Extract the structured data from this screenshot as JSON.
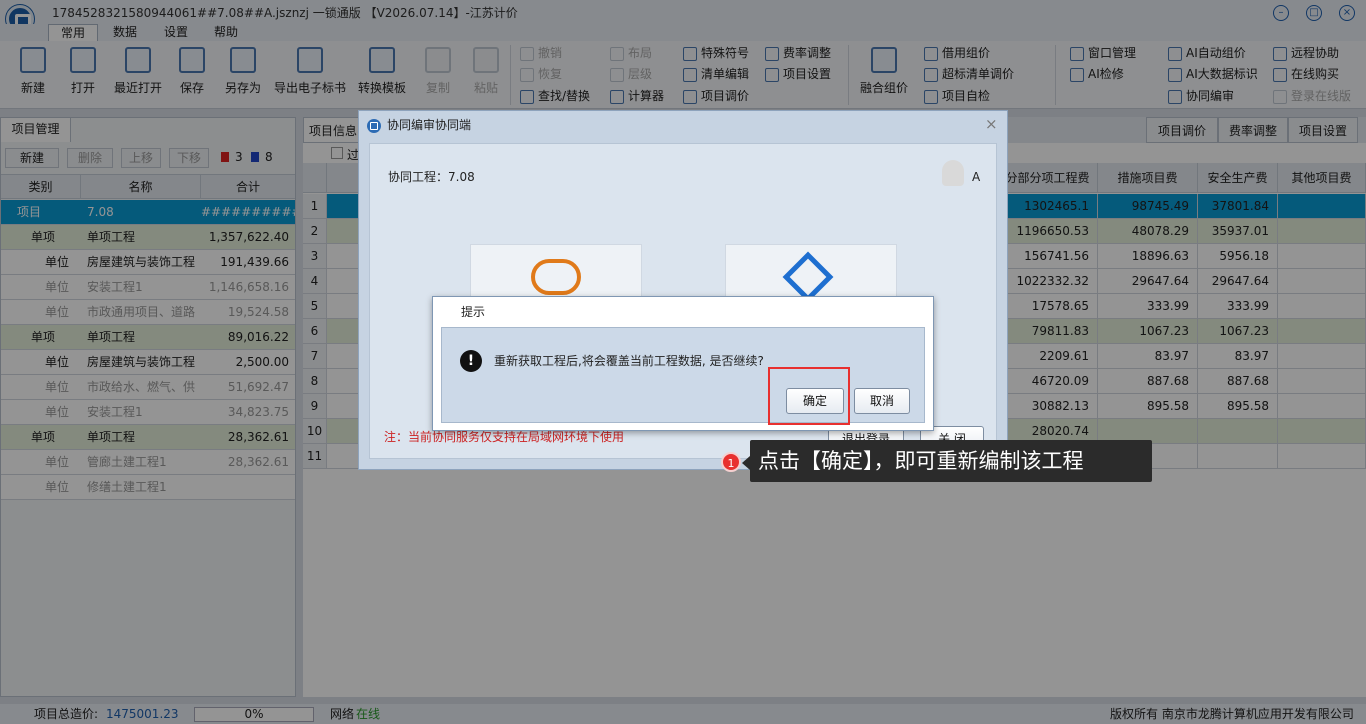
{
  "title": "1784528321580944061##7.08##A.jsznzj 一锁通版 【V2026.07.14】-江苏计价",
  "menu": [
    "常用",
    "数据",
    "设置",
    "帮助"
  ],
  "ribbon": {
    "big": [
      "新建",
      "打开",
      "最近打开",
      "保存",
      "另存为",
      "导出电子标书",
      "转换模板",
      "复制",
      "粘贴",
      "融合组价"
    ],
    "edit": [
      "撤销",
      "恢复",
      "查找/替换"
    ],
    "layout": [
      "布局",
      "层级",
      "计算器"
    ],
    "tools": [
      "特殊符号",
      "清单编辑",
      "项目调价"
    ],
    "rates": [
      "费率调整",
      "项目设置"
    ],
    "price": [
      "借用组价",
      "超标清单调价",
      "项目自检"
    ],
    "window": [
      "窗口管理",
      "AI检修"
    ],
    "ai": [
      "AI自动组价",
      "AI大数据标识",
      "协同编审"
    ],
    "remote": [
      "远程协助",
      "在线购买",
      "登录在线版"
    ]
  },
  "left": {
    "tab": "项目管理",
    "tools": {
      "new": "新建",
      "delete": "删除",
      "up": "上移",
      "down": "下移",
      "red_count": "3",
      "blue_count": "8"
    },
    "headers": [
      "类别",
      "名称",
      "合计"
    ],
    "rows": [
      {
        "type": "项目",
        "name": "7.08",
        "total": "###########"
      },
      {
        "type": "单项",
        "name": "单项工程",
        "total": "1,357,622.40"
      },
      {
        "type": "单位",
        "name": "房屋建筑与装饰工程",
        "total": "191,439.66"
      },
      {
        "type": "单位",
        "name": "安装工程1",
        "total": "1,146,658.16"
      },
      {
        "type": "单位",
        "name": "市政通用项目、道路",
        "total": "19,524.58"
      },
      {
        "type": "单项",
        "name": "单项工程",
        "total": "89,016.22"
      },
      {
        "type": "单位",
        "name": "房屋建筑与装饰工程",
        "total": "2,500.00"
      },
      {
        "type": "单位",
        "name": "市政给水、燃气、供",
        "total": "51,692.47"
      },
      {
        "type": "单位",
        "name": "安装工程1",
        "total": "34,823.75"
      },
      {
        "type": "单项",
        "name": "单项工程",
        "total": "28,362.61"
      },
      {
        "type": "单位",
        "name": "管廊土建工程1",
        "total": "28,362.61"
      },
      {
        "type": "单位",
        "name": "修缮土建工程1",
        "total": ""
      }
    ]
  },
  "right": {
    "tab": "项目信息",
    "tabs": [
      "项目调价",
      "费率调整",
      "项目设置"
    ],
    "checkbox_label": "过",
    "headers": [
      "分部分项工程费",
      "措施项目费",
      "安全生产费",
      "其他项目费"
    ],
    "rows": [
      {
        "n": "1",
        "a": "1302465.1",
        "b": "98745.49",
        "c": "37801.84"
      },
      {
        "n": "2",
        "a": "1196650.53",
        "b": "48078.29",
        "c": "35937.01"
      },
      {
        "n": "3",
        "a": "156741.56",
        "b": "18896.63",
        "c": "5956.18"
      },
      {
        "n": "4",
        "a": "1022332.32",
        "b": "29647.64",
        "c": "29647.64"
      },
      {
        "n": "5",
        "a": "17578.65",
        "b": "333.99",
        "c": "333.99"
      },
      {
        "n": "6",
        "a": "79811.83",
        "b": "1067.23",
        "c": "1067.23"
      },
      {
        "n": "7",
        "a": "2209.61",
        "b": "83.97",
        "c": "83.97"
      },
      {
        "n": "8",
        "a": "46720.09",
        "b": "887.68",
        "c": "887.68"
      },
      {
        "n": "9",
        "a": "30882.13",
        "b": "895.58",
        "c": "895.58"
      },
      {
        "n": "10",
        "a": "28020.74",
        "b": "",
        "c": ""
      },
      {
        "n": "11",
        "a": "",
        "b": "",
        "c": ""
      }
    ]
  },
  "collab": {
    "title": "协同编审协同端",
    "project": "协同工程：7.08",
    "user": "A",
    "note": "注：当前协同服务仅支持在局域网环境下使用",
    "logout": "退出登录",
    "close": "关 闭"
  },
  "prompt": {
    "title": "提示",
    "message": "重新获取工程后,将会覆盖当前工程数据, 是否继续?",
    "ok": "确定",
    "cancel": "取消"
  },
  "tip": {
    "num": "1",
    "text": "点击【确定】，即可重新编制该工程"
  },
  "status": {
    "total_label": "项目总造价:",
    "total": "1475001.23",
    "progress": "0%",
    "net_label": "网络",
    "net_state": "在线",
    "copyright": "版权所有 南京市龙腾计算机应用开发有限公司"
  },
  "colors": {
    "accent": "#1e5fae",
    "select": "#0a9bd5",
    "green_row": "#e3eed9",
    "highlight": "#e8302f",
    "note": "#cc2222"
  }
}
